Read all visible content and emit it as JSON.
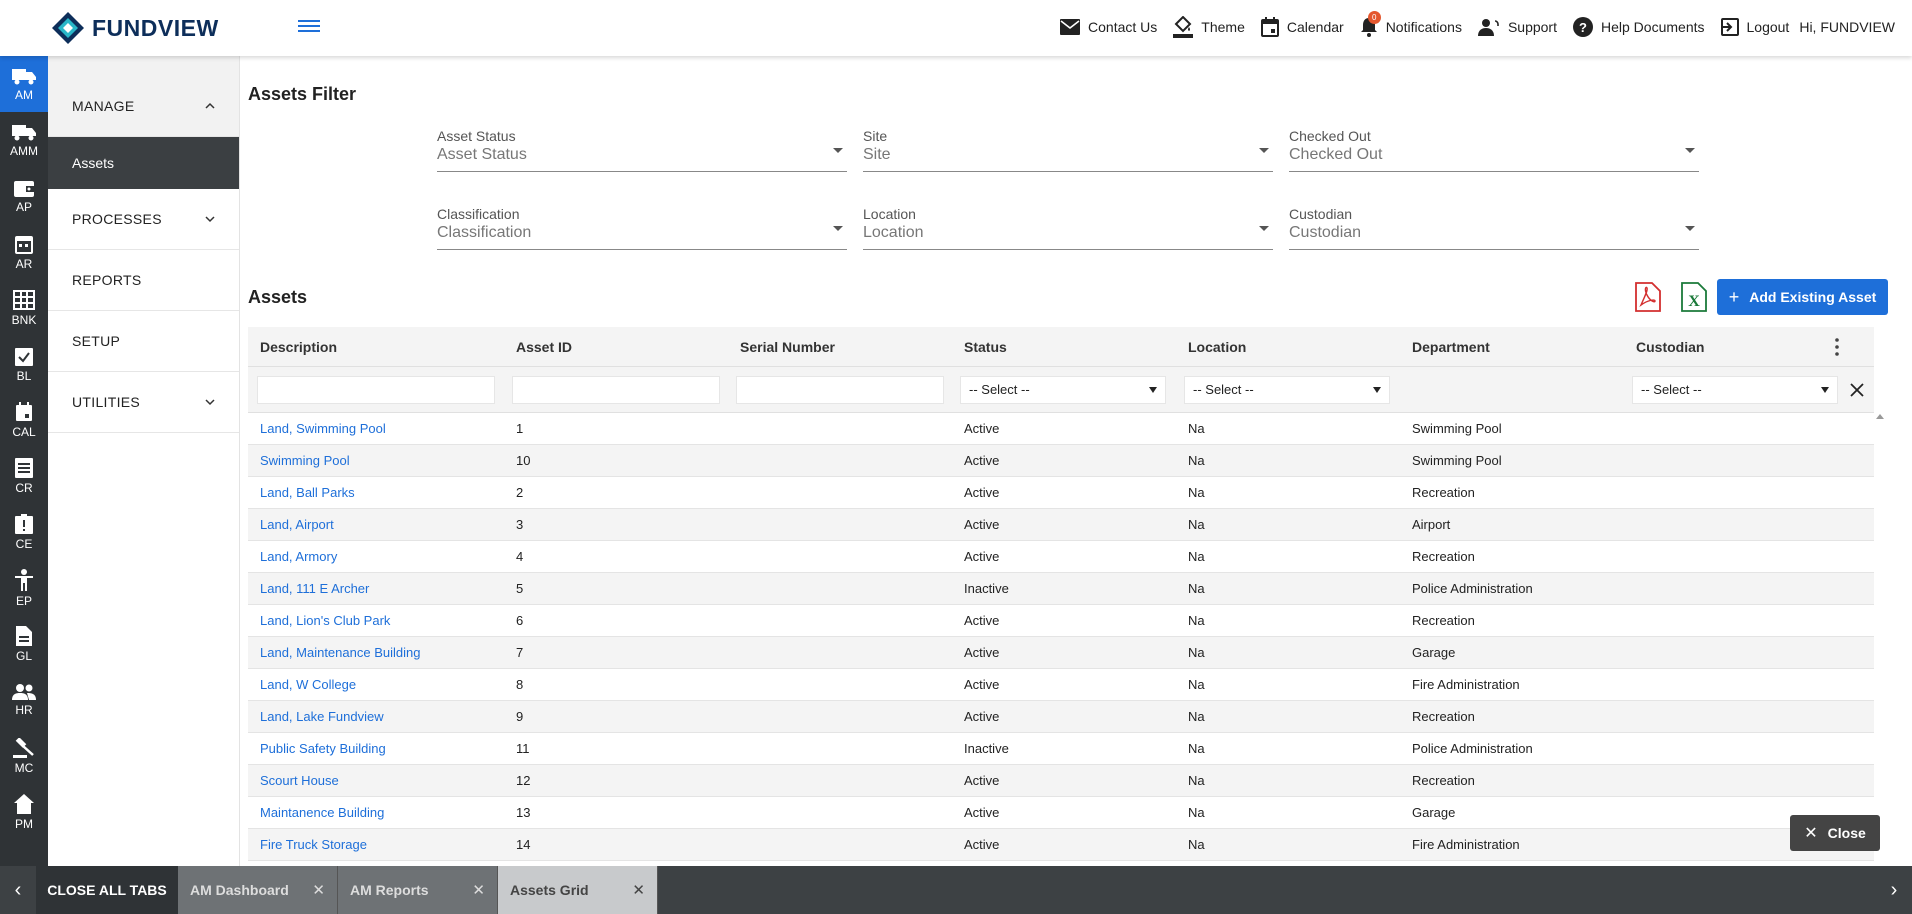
{
  "header": {
    "logo_text": "FUNDVIEW",
    "nav": [
      {
        "label": "Contact Us",
        "icon": "mail-icon"
      },
      {
        "label": "Theme",
        "icon": "paint-bucket-icon"
      },
      {
        "label": "Calendar",
        "icon": "calendar-icon"
      },
      {
        "label": "Notifications",
        "icon": "bell-icon",
        "badge": "0"
      },
      {
        "label": "Support",
        "icon": "support-icon"
      },
      {
        "label": "Help Documents",
        "icon": "help-icon"
      },
      {
        "label": "Logout",
        "icon": "logout-icon"
      }
    ],
    "greeting": "Hi, FUNDVIEW"
  },
  "rail": [
    {
      "label": "AM",
      "active": true
    },
    {
      "label": "AMM"
    },
    {
      "label": "AP"
    },
    {
      "label": "AR"
    },
    {
      "label": "BNK"
    },
    {
      "label": "BL"
    },
    {
      "label": "CAL"
    },
    {
      "label": "CR"
    },
    {
      "label": "CE"
    },
    {
      "label": "EP"
    },
    {
      "label": "GL"
    },
    {
      "label": "HR"
    },
    {
      "label": "MC"
    },
    {
      "label": "PM"
    }
  ],
  "subnav": {
    "manage": "MANAGE",
    "assets": "Assets",
    "processes": "PROCESSES",
    "reports": "REPORTS",
    "setup": "SETUP",
    "utilities": "UTILITIES"
  },
  "filter": {
    "title": "Assets Filter",
    "fields": [
      {
        "label": "Asset Status",
        "value": "Asset Status"
      },
      {
        "label": "Site",
        "value": "Site"
      },
      {
        "label": "Checked Out",
        "value": "Checked Out"
      },
      {
        "label": "Classification",
        "value": "Classification"
      },
      {
        "label": "Location",
        "value": "Location"
      },
      {
        "label": "Custodian",
        "value": "Custodian"
      }
    ]
  },
  "assets": {
    "title": "Assets",
    "add_button": "Add Existing Asset",
    "columns": [
      "Description",
      "Asset ID",
      "Serial Number",
      "Status",
      "Location",
      "Department",
      "Custodian"
    ],
    "select_placeholder": "-- Select --",
    "rows": [
      {
        "description": "Land, Swimming Pool",
        "id": "1",
        "serial": "",
        "status": "Active",
        "location": "Na",
        "department": "Swimming Pool",
        "custodian": ""
      },
      {
        "description": "Swimming Pool",
        "id": "10",
        "serial": "",
        "status": "Active",
        "location": "Na",
        "department": "Swimming Pool",
        "custodian": ""
      },
      {
        "description": "Land, Ball Parks",
        "id": "2",
        "serial": "",
        "status": "Active",
        "location": "Na",
        "department": "Recreation",
        "custodian": ""
      },
      {
        "description": "Land, Airport",
        "id": "3",
        "serial": "",
        "status": "Active",
        "location": "Na",
        "department": "Airport",
        "custodian": ""
      },
      {
        "description": "Land, Armory",
        "id": "4",
        "serial": "",
        "status": "Active",
        "location": "Na",
        "department": "Recreation",
        "custodian": ""
      },
      {
        "description": "Land, 111 E Archer",
        "id": "5",
        "serial": "",
        "status": "Inactive",
        "location": "Na",
        "department": "Police Administration",
        "custodian": ""
      },
      {
        "description": "Land, Lion's Club Park",
        "id": "6",
        "serial": "",
        "status": "Active",
        "location": "Na",
        "department": "Recreation",
        "custodian": ""
      },
      {
        "description": "Land, Maintenance Building",
        "id": "7",
        "serial": "",
        "status": "Active",
        "location": "Na",
        "department": "Garage",
        "custodian": ""
      },
      {
        "description": "Land, W College",
        "id": "8",
        "serial": "",
        "status": "Active",
        "location": "Na",
        "department": "Fire Administration",
        "custodian": ""
      },
      {
        "description": "Land, Lake Fundview",
        "id": "9",
        "serial": "",
        "status": "Active",
        "location": "Na",
        "department": "Recreation",
        "custodian": ""
      },
      {
        "description": "Public Safety Building",
        "id": "11",
        "serial": "",
        "status": "Inactive",
        "location": "Na",
        "department": "Police Administration",
        "custodian": ""
      },
      {
        "description": "Scourt House",
        "id": "12",
        "serial": "",
        "status": "Active",
        "location": "Na",
        "department": "Recreation",
        "custodian": ""
      },
      {
        "description": "Maintanence Building",
        "id": "13",
        "serial": "",
        "status": "Active",
        "location": "Na",
        "department": "Garage",
        "custodian": ""
      },
      {
        "description": "Fire Truck Storage",
        "id": "14",
        "serial": "",
        "status": "Active",
        "location": "Na",
        "department": "Fire Administration",
        "custodian": ""
      }
    ]
  },
  "close_button": "Close",
  "tabs": {
    "close_all": "CLOSE ALL TABS",
    "items": [
      {
        "label": "AM Dashboard"
      },
      {
        "label": "AM Reports"
      },
      {
        "label": "Assets Grid",
        "active": true
      }
    ]
  },
  "colors": {
    "accent": "#1e6fd9",
    "rail_bg": "#2f3336",
    "pdf_red": "#d32f2f",
    "excel_green": "#1b7a3a"
  }
}
